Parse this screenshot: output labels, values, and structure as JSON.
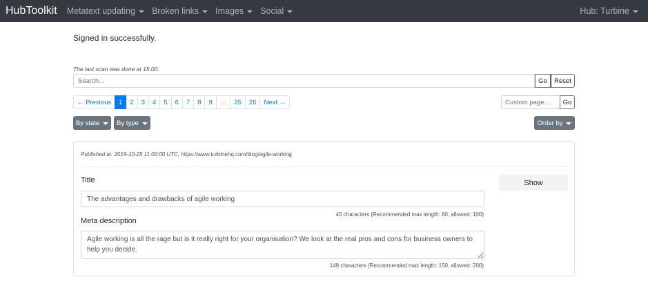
{
  "navbar": {
    "brand": "HubToolkit",
    "menus": [
      {
        "label": "Metatext updating"
      },
      {
        "label": "Broken links"
      },
      {
        "label": "Images"
      },
      {
        "label": "Social"
      }
    ],
    "hub_label": "Hub: Turbine"
  },
  "flash": "Signed in successfully.",
  "scan_note": "The last scan was done at 15:00.",
  "search": {
    "placeholder": "Search...",
    "go_label": "Go",
    "reset_label": "Reset"
  },
  "pagination": {
    "previous": "← Previous",
    "pages": [
      "1",
      "2",
      "3",
      "4",
      "5",
      "6",
      "7",
      "8",
      "9",
      "…",
      "25",
      "26"
    ],
    "active": "1",
    "next": "Next →"
  },
  "custom_page": {
    "placeholder": "Custom page...",
    "go_label": "Go"
  },
  "filters": {
    "by_state": "By state",
    "by_type": "By type",
    "order_by": "Order by"
  },
  "card": {
    "published_label": "Published at: 2019-10-25 11:00:00 UTC,",
    "url": "https://www.turbinehq.com/blog/agile-working",
    "title_label": "Title",
    "title_value": "The advantages and drawbacks of agile working",
    "title_counter": "45 characters (Recommended max length: 60, allowed: 100)",
    "desc_label": "Meta description",
    "desc_value": "Agile working is all the rage but is it really right for your organisation? We look at the real pros and cons for business owners to help you decide.",
    "desc_counter": "149 characters (Recommended max length: 150, allowed: 200)",
    "show_label": "Show"
  },
  "colors": {
    "navbar_bg": "#343a40",
    "primary": "#007bff",
    "secondary": "#6c757d"
  }
}
